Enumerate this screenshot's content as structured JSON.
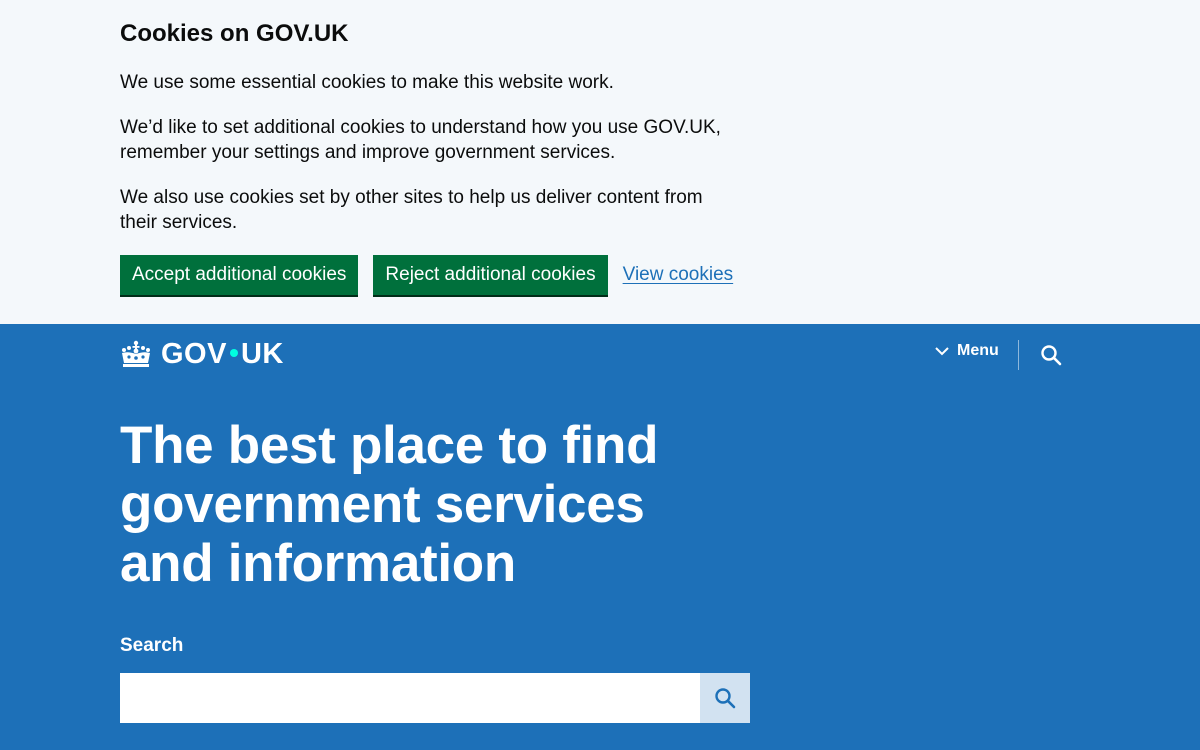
{
  "cookie_banner": {
    "title": "Cookies on GOV.UK",
    "paragraph_1": "We use some essential cookies to make this website work.",
    "paragraph_2": "We’d like to set additional cookies to understand how you use GOV.UK, remember your settings and improve government services.",
    "paragraph_3": "We also use cookies set by other sites to help us deliver content from their services.",
    "accept_label": "Accept additional cookies",
    "reject_label": "Reject additional cookies",
    "view_label": "View cookies"
  },
  "header": {
    "logo_left": "GOV",
    "logo_right": "UK",
    "menu_label": "Menu"
  },
  "hero": {
    "title": "The best place to find government services and information",
    "search_label": "Search",
    "search_value": ""
  },
  "colors": {
    "brand_blue": "#1d70b8",
    "button_green": "#00703c",
    "banner_bg": "#f4f8fb",
    "link_blue": "#1d70b8"
  }
}
